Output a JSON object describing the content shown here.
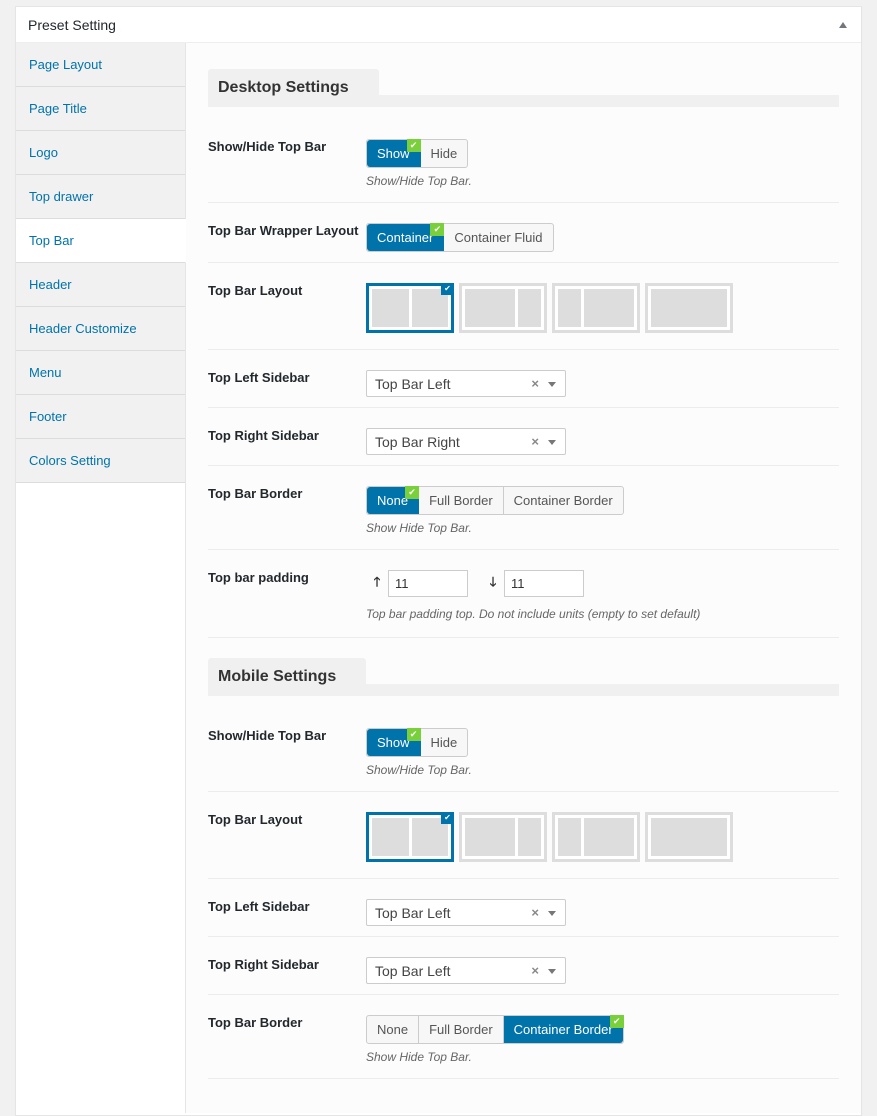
{
  "panel": {
    "title": "Preset Setting"
  },
  "sidebar": {
    "items": [
      {
        "label": "Page Layout"
      },
      {
        "label": "Page Title"
      },
      {
        "label": "Logo"
      },
      {
        "label": "Top drawer"
      },
      {
        "label": "Top Bar"
      },
      {
        "label": "Header"
      },
      {
        "label": "Header Customize"
      },
      {
        "label": "Menu"
      },
      {
        "label": "Footer"
      },
      {
        "label": "Colors Setting"
      }
    ],
    "active": "Top Bar"
  },
  "desktop": {
    "title": "Desktop Settings",
    "show_hide": {
      "label": "Show/Hide Top Bar",
      "options": [
        "Show",
        "Hide"
      ],
      "selected": "Show",
      "desc": "Show/Hide Top Bar."
    },
    "wrapper": {
      "label": "Top Bar Wrapper Layout",
      "options": [
        "Container",
        "Container Fluid"
      ],
      "selected": "Container"
    },
    "layout": {
      "label": "Top Bar Layout",
      "selected_index": 0
    },
    "left_sidebar": {
      "label": "Top Left Sidebar",
      "value": "Top Bar Left"
    },
    "right_sidebar": {
      "label": "Top Right Sidebar",
      "value": "Top Bar Right"
    },
    "border": {
      "label": "Top Bar Border",
      "options": [
        "None",
        "Full Border",
        "Container Border"
      ],
      "selected": "None",
      "desc": "Show Hide Top Bar."
    },
    "padding": {
      "label": "Top bar padding",
      "top": "11",
      "bottom": "11",
      "desc": "Top bar padding top. Do not include units (empty to set default)"
    }
  },
  "mobile": {
    "title": "Mobile Settings",
    "show_hide": {
      "label": "Show/Hide Top Bar",
      "options": [
        "Show",
        "Hide"
      ],
      "selected": "Show",
      "desc": "Show/Hide Top Bar."
    },
    "layout": {
      "label": "Top Bar Layout",
      "selected_index": 0
    },
    "left_sidebar": {
      "label": "Top Left Sidebar",
      "value": "Top Bar Left"
    },
    "right_sidebar": {
      "label": "Top Right Sidebar",
      "value": "Top Bar Left"
    },
    "border": {
      "label": "Top Bar Border",
      "options": [
        "None",
        "Full Border",
        "Container Border"
      ],
      "selected": "Container Border",
      "desc": "Show Hide Top Bar."
    }
  },
  "icons": {
    "clear": "×",
    "check": "✔",
    "up": "🡑",
    "down": "🡓"
  },
  "colors": {
    "accent": "#0073aa",
    "check_green": "#7ad03a"
  }
}
